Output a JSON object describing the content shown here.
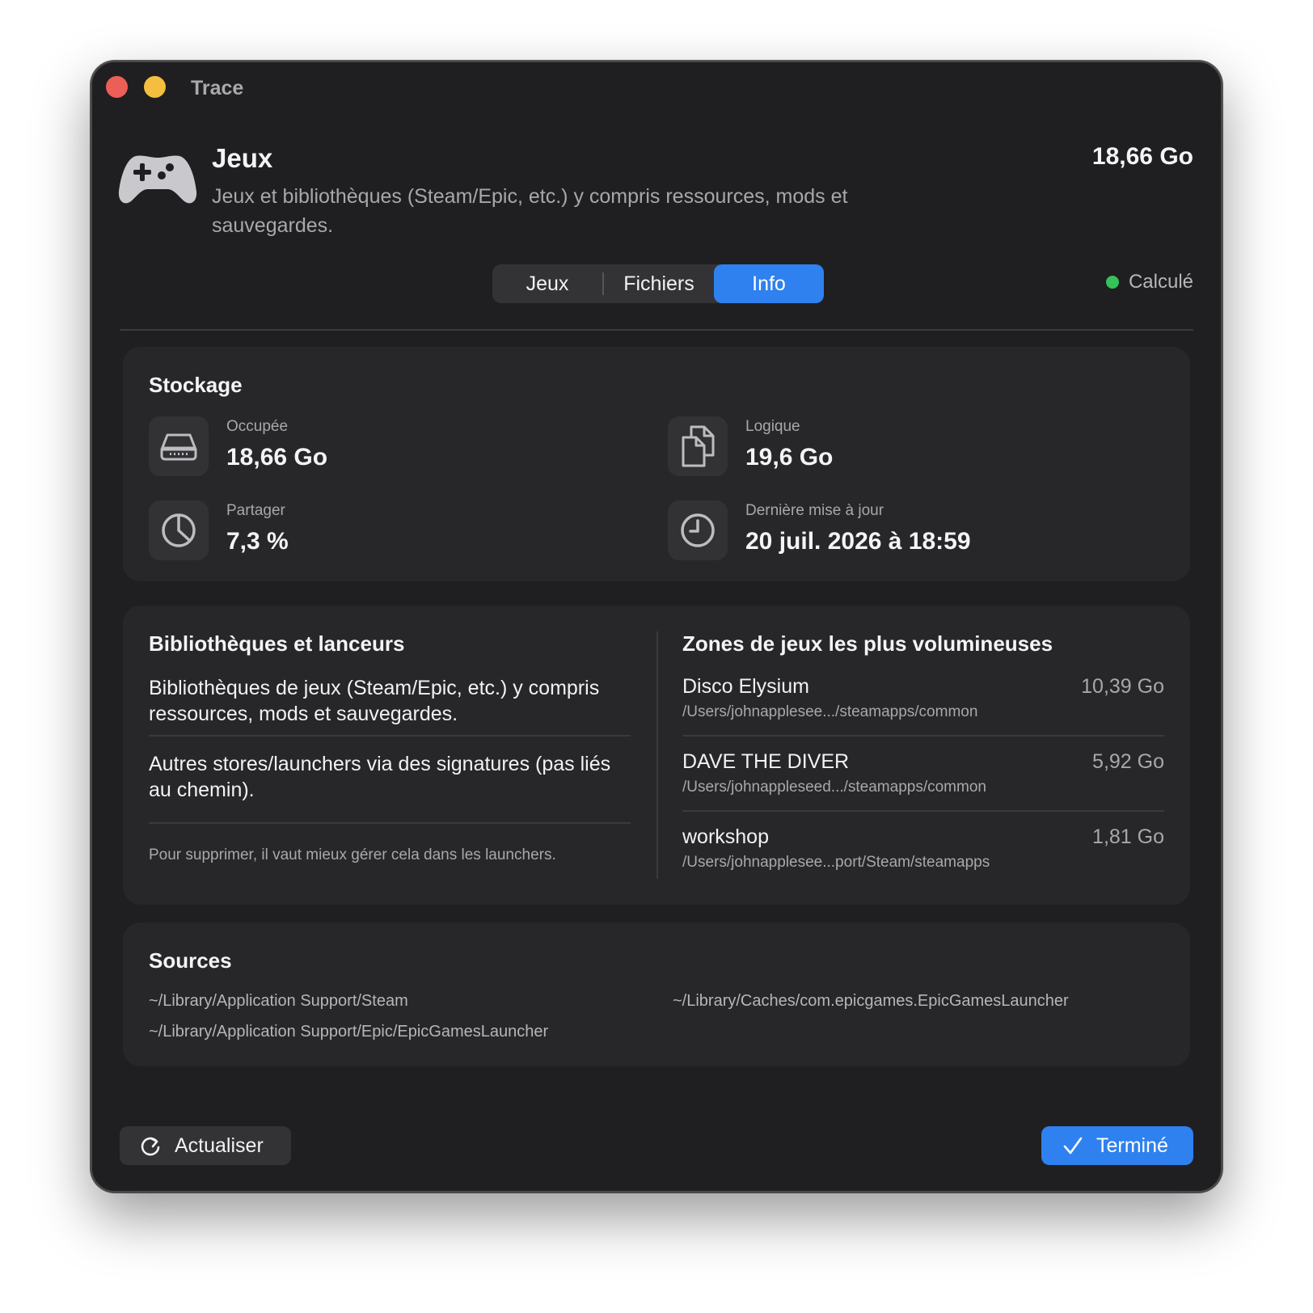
{
  "window": {
    "title": "Trace"
  },
  "header": {
    "icon": "gamecontroller-icon",
    "title": "Jeux",
    "description": "Jeux et bibliothèques (Steam/Epic, etc.) y compris ressources, mods et sauvegardes.",
    "size": "18,66 Go"
  },
  "tabs": [
    {
      "label": "Jeux",
      "active": false
    },
    {
      "label": "Fichiers",
      "active": false
    },
    {
      "label": "Info",
      "active": true
    }
  ],
  "status": {
    "label": "Calculé",
    "color": "#36c159"
  },
  "storage": {
    "title": "Stockage",
    "stats": [
      {
        "icon": "internal-drive-icon",
        "label": "Occupée",
        "value": "18,66 Go"
      },
      {
        "icon": "documents-icon",
        "label": "Logique",
        "value": "19,6 Go"
      },
      {
        "icon": "pie-chart-icon",
        "label": "Partager",
        "value": "7,3 %"
      },
      {
        "icon": "clock-icon",
        "label": "Dernière mise à jour",
        "value": "20 juil. 2026 à 18:59"
      }
    ]
  },
  "libraries": {
    "title": "Bibliothèques et lanceurs",
    "paragraphs": [
      "Bibliothèques de jeux (Steam/Epic, etc.) y compris ressources, mods et sauvegardes.",
      "Autres stores/launchers via des signatures (pas liés au chemin)."
    ],
    "note": "Pour supprimer, il vaut mieux gérer cela dans les launchers."
  },
  "zones": {
    "title": "Zones de jeux les plus volumineuses",
    "items": [
      {
        "name": "Disco Elysium",
        "path": "/Users/johnapplesee.../steamapps/common",
        "size": "10,39 Go"
      },
      {
        "name": "DAVE THE DIVER",
        "path": "/Users/johnappleseed.../steamapps/common",
        "size": "5,92 Go"
      },
      {
        "name": "workshop",
        "path": "/Users/johnapplesee...port/Steam/steamapps",
        "size": "1,81 Go"
      }
    ]
  },
  "sources": {
    "title": "Sources",
    "paths": [
      "~/Library/Application Support/Steam",
      "~/Library/Caches/com.epicgames.EpicGamesLauncher",
      "~/Library/Application Support/Epic/EpicGamesLauncher"
    ]
  },
  "footer": {
    "refresh_label": "Actualiser",
    "done_label": "Terminé"
  },
  "colors": {
    "accent": "#2f81ef",
    "window_bg": "#1f1f21",
    "card_bg": "#27272a"
  }
}
